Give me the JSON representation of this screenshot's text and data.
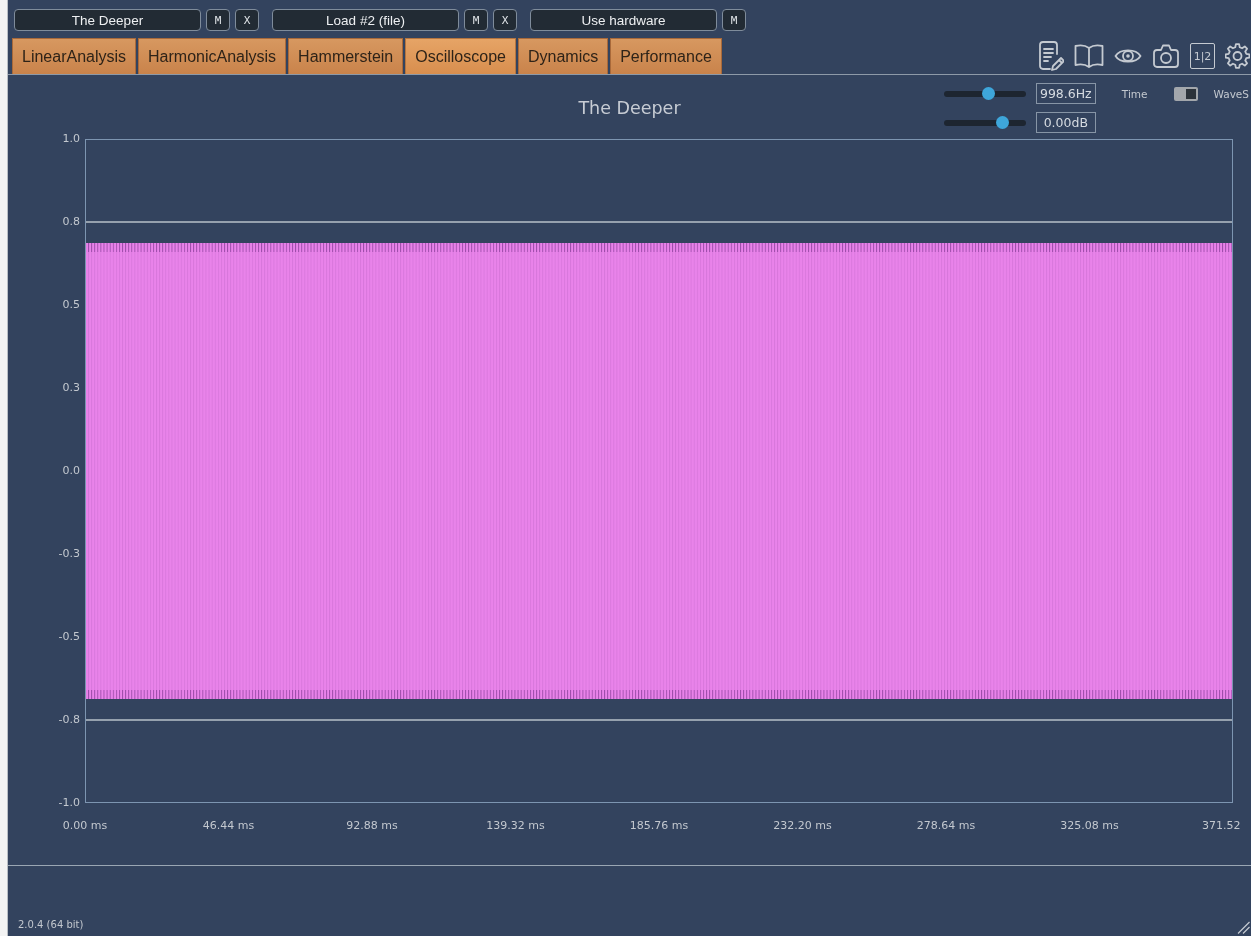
{
  "top_bar": {
    "channels": [
      {
        "name": "The Deeper",
        "buttons": [
          "M",
          "X"
        ]
      },
      {
        "name": "Load #2 (file)",
        "buttons": [
          "M",
          "X"
        ]
      },
      {
        "name": "Use hardware",
        "buttons": [
          "M"
        ]
      }
    ]
  },
  "tabs": [
    {
      "label": "LinearAnalysis",
      "selected": false
    },
    {
      "label": "HarmonicAnalysis",
      "selected": false
    },
    {
      "label": "Hammerstein",
      "selected": false
    },
    {
      "label": "Oscilloscope",
      "selected": true
    },
    {
      "label": "Dynamics",
      "selected": false
    },
    {
      "label": "Performance",
      "selected": false
    }
  ],
  "toolbar": {
    "split_view_label": "1|2"
  },
  "oscilloscope": {
    "title": "The Deeper",
    "frequency": {
      "level": 0.55,
      "reading": "998.6Hz"
    },
    "gain": {
      "level": 0.71,
      "reading": "0.00dB"
    },
    "time_label": "Time",
    "mode_switch": {
      "on": true
    },
    "wave_label": "WaveS",
    "y_tick_labels": [
      "1.0",
      "0.8",
      "0.5",
      "0.3",
      "0.0",
      "-0.3",
      "-0.5",
      "-0.8",
      "-1.0"
    ],
    "x_tick_labels": [
      "0.00 ms",
      "46.44 ms",
      "92.88 ms",
      "139.32 ms",
      "185.76 ms",
      "232.20 ms",
      "278.64 ms",
      "325.08 ms",
      "371.52"
    ]
  },
  "status_bar": {
    "version": "2.0.4 (64 bit)"
  }
}
